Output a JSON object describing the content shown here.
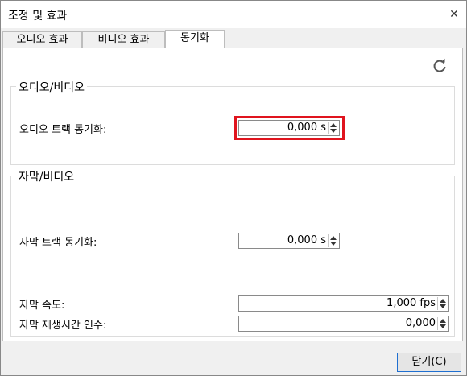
{
  "window": {
    "title": "조정 및 효과"
  },
  "tabs": [
    {
      "label": "오디오 효과"
    },
    {
      "label": "비디오 효과"
    },
    {
      "label": "동기화"
    }
  ],
  "audio_video": {
    "group_title": "오디오/비디오",
    "audio_track_sync": {
      "label": "오디오 트랙 동기화:",
      "value": "0,000 s"
    }
  },
  "subtitle_video": {
    "group_title": "자막/비디오",
    "subtitle_track_sync": {
      "label": "자막 트랙 동기화:",
      "value": "0,000 s"
    },
    "subtitle_speed": {
      "label": "자막 속도:",
      "value": "1,000 fps"
    },
    "subtitle_duration_factor": {
      "label": "자막 재생시간 인수:",
      "value": "0,000"
    }
  },
  "footer": {
    "close_label": "닫기(C)"
  },
  "colors": {
    "highlight": "#e0141e",
    "default_button_border": "#1f6fd0"
  }
}
